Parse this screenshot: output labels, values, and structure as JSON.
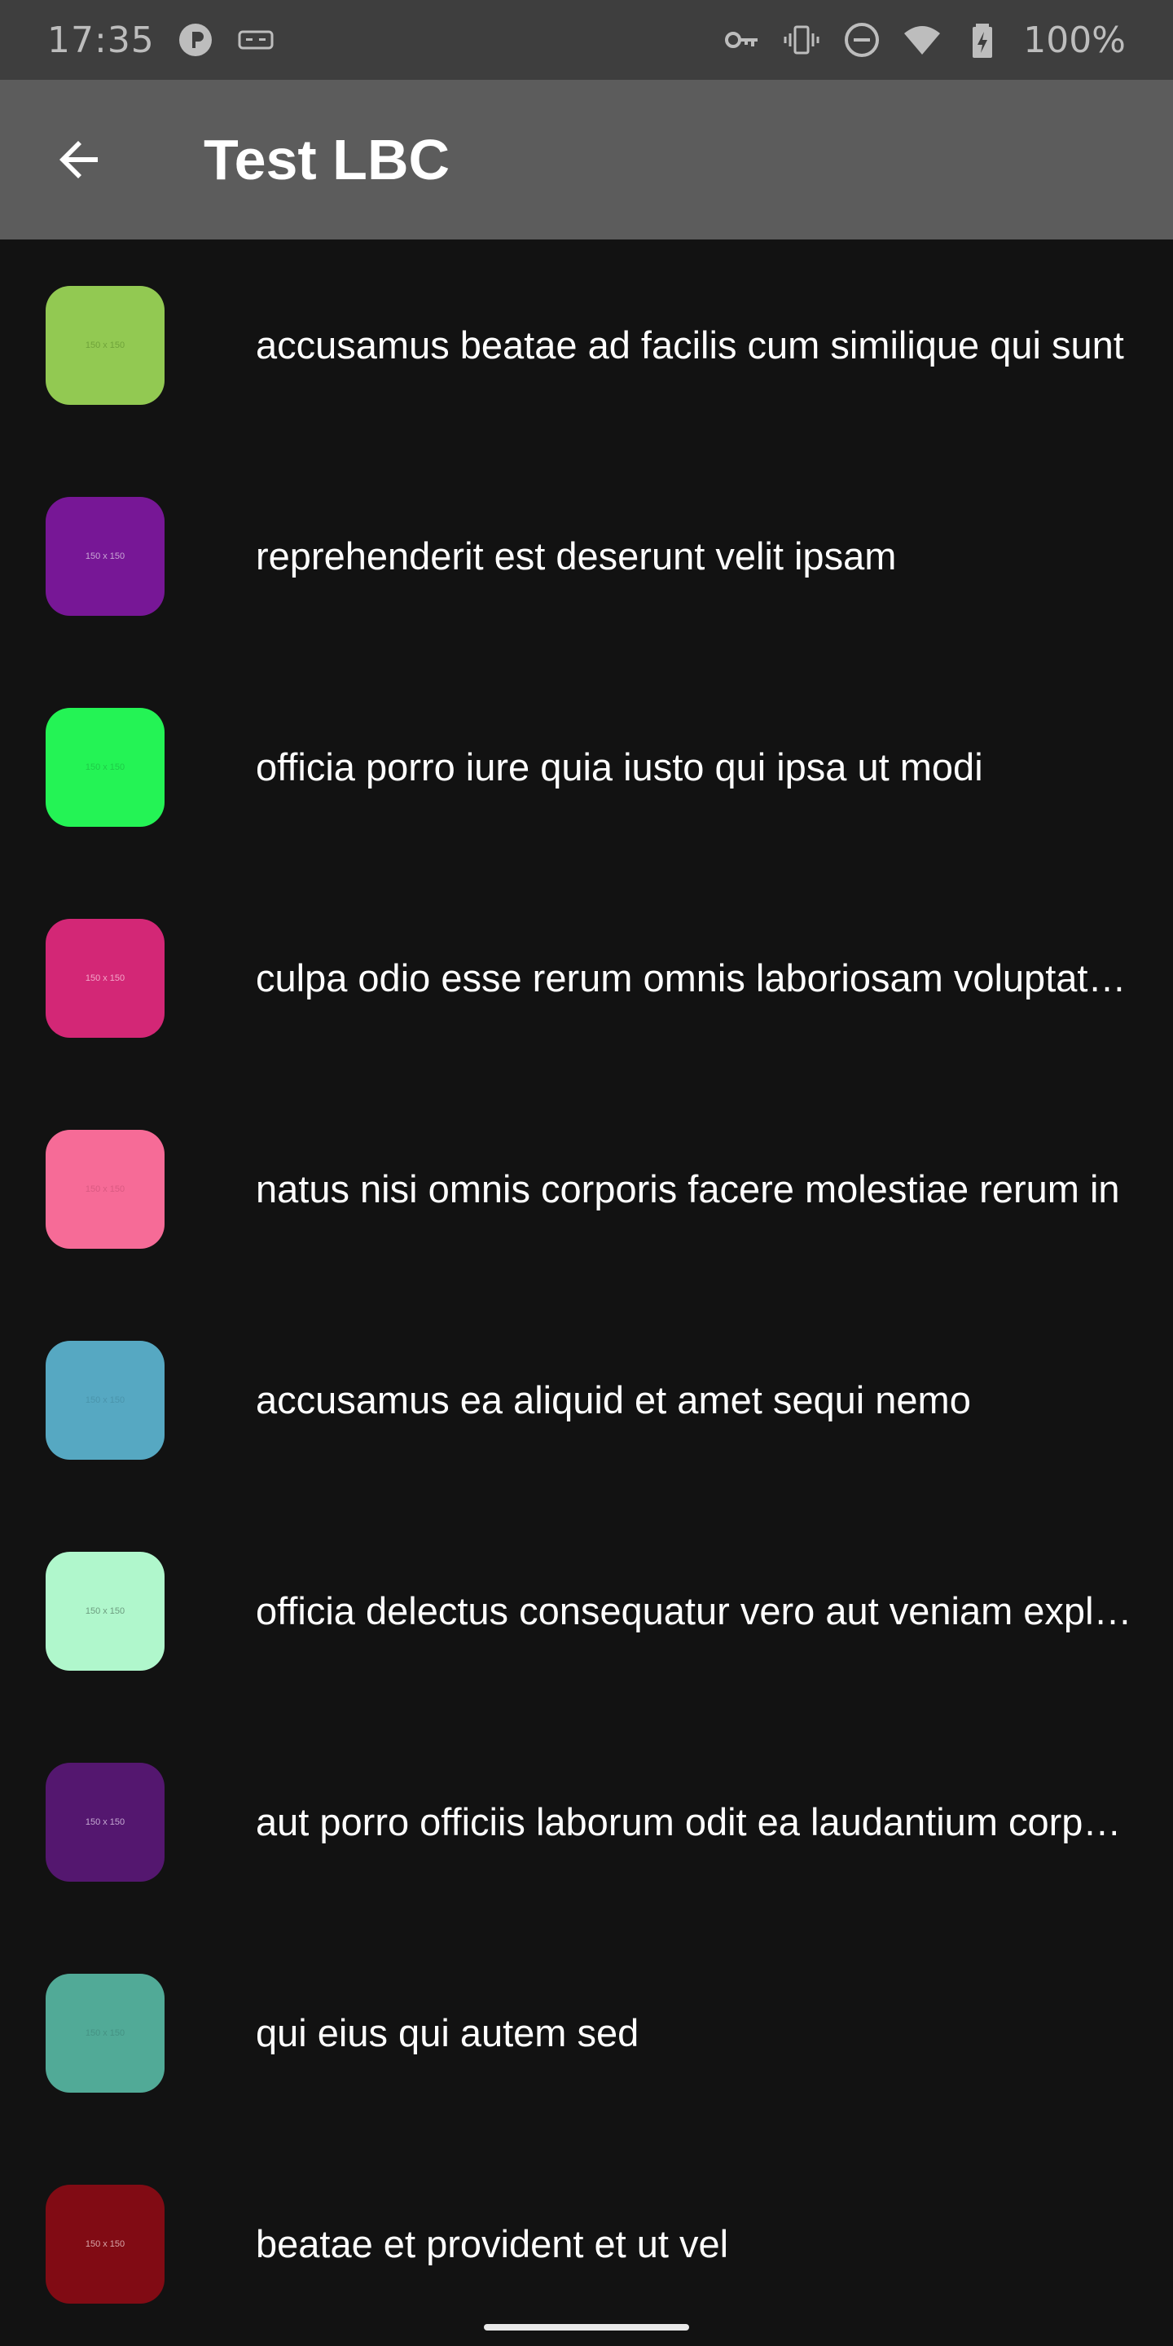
{
  "status_bar": {
    "time": "17:35",
    "battery_text": "100%",
    "icons_left": [
      "app-notification-icon",
      "game-controller-icon"
    ],
    "icons_right": [
      "vpn-key-icon",
      "vibrate-icon",
      "do-not-disturb-icon",
      "wifi-icon",
      "battery-charging-icon"
    ]
  },
  "app_bar": {
    "title": "Test LBC",
    "back_icon": "arrow-back-icon"
  },
  "list": {
    "items": [
      {
        "title": "accusamus beatae ad facilis cum similique qui sunt",
        "thumb_label": "150 x 150",
        "color": "#92c952",
        "label_color": "#6fa33a"
      },
      {
        "title": "reprehenderit est deserunt velit ipsam",
        "thumb_label": "150 x 150",
        "color": "#771796",
        "label_color": "#c9a6d6"
      },
      {
        "title": "officia porro iure quia iusto qui ipsa ut modi",
        "thumb_label": "150 x 150",
        "color": "#24f355",
        "label_color": "#1ecb47"
      },
      {
        "title": "culpa odio esse rerum omnis laboriosam voluptate repudiandae",
        "thumb_label": "150 x 150",
        "color": "#d32776",
        "label_color": "#f3a6c9"
      },
      {
        "title": "natus nisi omnis corporis facere molestiae rerum in",
        "thumb_label": "150 x 150",
        "color": "#f66b97",
        "label_color": "#d95a82"
      },
      {
        "title": "accusamus ea aliquid et amet sequi nemo",
        "thumb_label": "150 x 150",
        "color": "#56a8c2",
        "label_color": "#4a94ab"
      },
      {
        "title": "officia delectus consequatur vero aut veniam explicabo molestias",
        "thumb_label": "150 x 150",
        "color": "#b0f7cc",
        "label_color": "#6c9c7f"
      },
      {
        "title": "aut porro officiis laborum odit ea laudantium corporis",
        "thumb_label": "150 x 150",
        "color": "#54176f",
        "label_color": "#c5a9d2"
      },
      {
        "title": "qui eius qui autem sed",
        "thumb_label": "150 x 150",
        "color": "#51aa97",
        "label_color": "#459283"
      },
      {
        "title": "beatae et provident et ut vel",
        "thumb_label": "150 x 150",
        "color": "#810b14",
        "label_color": "#d8a6a9"
      }
    ]
  }
}
